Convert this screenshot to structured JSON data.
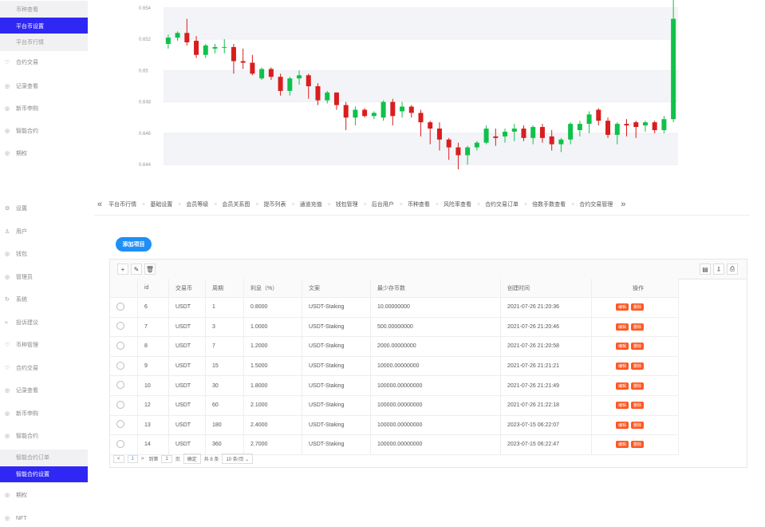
{
  "sidebar_top": {
    "items": [
      {
        "label": "币种查看",
        "type": "sub"
      },
      {
        "label": "平台币设置",
        "type": "active"
      },
      {
        "label": "平台币行情",
        "type": "sub"
      },
      {
        "label": "合约交易",
        "icon": "♡"
      },
      {
        "label": "记录查看",
        "icon": "◎"
      },
      {
        "label": "新币申购",
        "icon": "◎"
      },
      {
        "label": "智能合约",
        "icon": "◎"
      },
      {
        "label": "期权",
        "icon": "◎"
      }
    ]
  },
  "sidebar_bottom": {
    "items": [
      {
        "label": "设置",
        "icon": "⚙"
      },
      {
        "label": "用户",
        "icon": "♙"
      },
      {
        "label": "钱包",
        "icon": "◎"
      },
      {
        "label": "管理员",
        "icon": "◎"
      },
      {
        "label": "系统",
        "icon": "↻"
      },
      {
        "label": "投诉建议",
        "icon": "≈"
      },
      {
        "label": "币种管理",
        "icon": "♡"
      },
      {
        "label": "合约交易",
        "icon": "♡"
      },
      {
        "label": "记录查看",
        "icon": "◎"
      },
      {
        "label": "新币申购",
        "icon": "◎"
      },
      {
        "label": "智能合约",
        "icon": "◎"
      },
      {
        "label": "智能合约订单",
        "type": "sub"
      },
      {
        "label": "智能合约设置",
        "type": "active"
      },
      {
        "label": "期权",
        "icon": "◎"
      },
      {
        "label": "NFT",
        "icon": "◎"
      }
    ]
  },
  "chart_data": {
    "type": "candlestick",
    "yticks": [
      "0.654",
      "0.652",
      "0.65",
      "0.648",
      "0.646",
      "0.644"
    ],
    "ylim": [
      0.6435,
      0.6545
    ],
    "colors": {
      "up": "#0fc14a",
      "down": "#d81e1e"
    },
    "candles": [
      [
        0.6517,
        0.6521,
        0.6514,
        0.6523
      ],
      [
        0.6521,
        0.6524,
        0.6519,
        0.6525
      ],
      [
        0.6524,
        0.6518,
        0.6516,
        0.6533
      ],
      [
        0.6519,
        0.651,
        0.6508,
        0.6522
      ],
      [
        0.651,
        0.6516,
        0.6508,
        0.6517
      ],
      [
        0.6514,
        0.6515,
        0.6511,
        0.6517
      ],
      [
        0.6515,
        0.6515,
        0.6511,
        0.652
      ],
      [
        0.6515,
        0.6506,
        0.6498,
        0.6517
      ],
      [
        0.6506,
        0.6505,
        0.6501,
        0.6514
      ],
      [
        0.6505,
        0.6498,
        0.6497,
        0.651
      ],
      [
        0.6495,
        0.6501,
        0.6494,
        0.6502
      ],
      [
        0.6501,
        0.6496,
        0.6494,
        0.6502
      ],
      [
        0.6496,
        0.6487,
        0.6484,
        0.6498
      ],
      [
        0.6487,
        0.6495,
        0.6484,
        0.6496
      ],
      [
        0.6495,
        0.6497,
        0.6491,
        0.65
      ],
      [
        0.6497,
        0.649,
        0.6482,
        0.6498
      ],
      [
        0.649,
        0.6481,
        0.6478,
        0.6492
      ],
      [
        0.6481,
        0.6486,
        0.6479,
        0.6487
      ],
      [
        0.6486,
        0.6478,
        0.6475,
        0.6486
      ],
      [
        0.6478,
        0.647,
        0.6462,
        0.648
      ],
      [
        0.647,
        0.6475,
        0.6465,
        0.6477
      ],
      [
        0.6475,
        0.6471,
        0.647,
        0.6476
      ],
      [
        0.6471,
        0.6473,
        0.6469,
        0.6474
      ],
      [
        0.647,
        0.648,
        0.6468,
        0.6481
      ],
      [
        0.648,
        0.6471,
        0.6465,
        0.6482
      ],
      [
        0.6474,
        0.6477,
        0.647,
        0.648
      ],
      [
        0.6477,
        0.6473,
        0.647,
        0.6478
      ],
      [
        0.6473,
        0.6467,
        0.6458,
        0.6475
      ],
      [
        0.6467,
        0.6463,
        0.6453,
        0.6468
      ],
      [
        0.6463,
        0.6456,
        0.6449,
        0.6467
      ],
      [
        0.6456,
        0.6451,
        0.6443,
        0.6457
      ],
      [
        0.6451,
        0.6446,
        0.6437,
        0.6454
      ],
      [
        0.6446,
        0.6451,
        0.644,
        0.6452
      ],
      [
        0.6451,
        0.6454,
        0.6449,
        0.6455
      ],
      [
        0.6454,
        0.6463,
        0.6453,
        0.6465
      ],
      [
        0.6458,
        0.6457,
        0.6452,
        0.6463
      ],
      [
        0.6458,
        0.6461,
        0.6454,
        0.6463
      ],
      [
        0.6461,
        0.6463,
        0.6455,
        0.6466
      ],
      [
        0.6463,
        0.6457,
        0.6455,
        0.6465
      ],
      [
        0.6457,
        0.6464,
        0.6453,
        0.6465
      ],
      [
        0.6464,
        0.6457,
        0.6454,
        0.6466
      ],
      [
        0.6458,
        0.6453,
        0.6449,
        0.6462
      ],
      [
        0.6453,
        0.6456,
        0.6448,
        0.6457
      ],
      [
        0.6456,
        0.6466,
        0.6453,
        0.6467
      ],
      [
        0.6462,
        0.6466,
        0.6458,
        0.6468
      ],
      [
        0.6466,
        0.6472,
        0.646,
        0.6474
      ],
      [
        0.6475,
        0.6468,
        0.6465,
        0.6476
      ],
      [
        0.6468,
        0.6459,
        0.6457,
        0.647
      ],
      [
        0.6459,
        0.6466,
        0.6453,
        0.6467
      ],
      [
        0.6466,
        0.6465,
        0.6458,
        0.6469
      ],
      [
        0.6467,
        0.6464,
        0.6457,
        0.6468
      ],
      [
        0.6465,
        0.6467,
        0.6461,
        0.6468
      ],
      [
        0.6467,
        0.6462,
        0.646,
        0.6468
      ],
      [
        0.6462,
        0.6469,
        0.646,
        0.6471
      ],
      [
        0.6469,
        0.6533,
        0.6467,
        0.6545
      ]
    ]
  },
  "tabs": {
    "left_arrow": "«",
    "right_arrow": "»",
    "items": [
      "平台币行情",
      "基础设置",
      "会员等级",
      "会员关系图",
      "提币列表",
      "通道充值",
      "钱包管理",
      "后台用户",
      "币种查看",
      "风险率查看",
      "合约交易订单",
      "倍数手数查看",
      "合约交易管理"
    ],
    "close": "×"
  },
  "content": {
    "add_button": "添加项目",
    "toolbar_left": [
      "+",
      "✎",
      "🗑"
    ],
    "toolbar_right": [
      "▤",
      "⇩",
      "⎙"
    ],
    "columns": [
      "id",
      "交易币",
      "周期",
      "利息（%）",
      "文案",
      "最少存币数",
      "创建时间",
      "操作"
    ],
    "rows": [
      [
        "6",
        "USDT",
        "1",
        "0.8000",
        "USDT-Staking",
        "10.00000000",
        "2021-07-26 21:20:36"
      ],
      [
        "7",
        "USDT",
        "3",
        "1.0000",
        "USDT-Staking",
        "500.00000000",
        "2021-07-26 21:20:46"
      ],
      [
        "8",
        "USDT",
        "7",
        "1.2000",
        "USDT-Staking",
        "2000.00000000",
        "2021-07-26 21:20:58"
      ],
      [
        "9",
        "USDT",
        "15",
        "1.5000",
        "USDT-Staking",
        "10000.00000000",
        "2021-07-26 21:21:21"
      ],
      [
        "10",
        "USDT",
        "30",
        "1.8000",
        "USDT-Staking",
        "100000.00000000",
        "2021-07-26 21:21:49"
      ],
      [
        "12",
        "USDT",
        "60",
        "2.1000",
        "USDT-Staking",
        "100000.00000000",
        "2021-07-26 21:22:18"
      ],
      [
        "13",
        "USDT",
        "180",
        "2.4000",
        "USDT-Staking",
        "100000.00000000",
        "2023-07-15 06:22:07"
      ],
      [
        "14",
        "USDT",
        "360",
        "2.7000",
        "USDT-Staking",
        "100000.00000000",
        "2023-07-15 06:22:47"
      ]
    ],
    "edit_label": "编辑",
    "delete_label": "删除",
    "pager": {
      "prev": "<",
      "page": "1",
      "next": ">",
      "goto_label": "到第",
      "goto_value": "1",
      "page_unit": "页",
      "confirm": "确定",
      "total": "共 8 条",
      "page_size": "10 条/页 ⌄"
    }
  }
}
